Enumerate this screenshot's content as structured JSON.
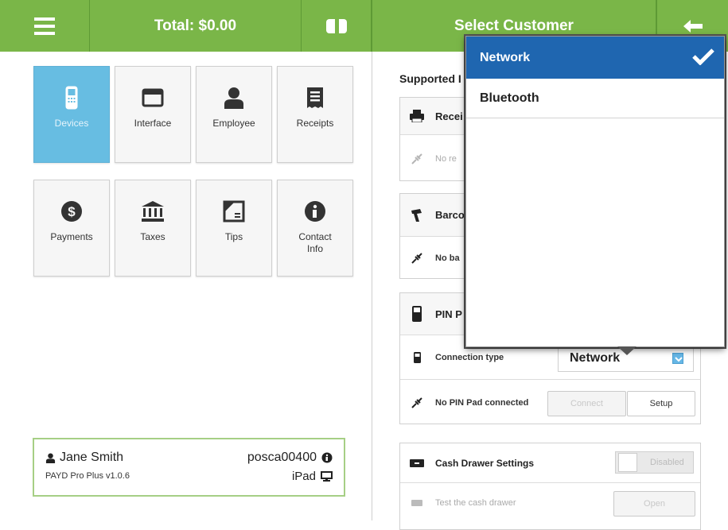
{
  "header": {
    "total_label": "Total: $0.00",
    "select_customer_label": "Select Customer",
    "menu_icon": "hamburger-menu-icon",
    "cash_icon": "cash-icon",
    "back_icon": "back-arrow-icon",
    "accent_color": "#7ab648"
  },
  "settings_tiles": [
    {
      "label": "Devices",
      "icon": "devices-icon",
      "active": true
    },
    {
      "label": "Interface",
      "icon": "window-icon",
      "active": false
    },
    {
      "label": "Employee",
      "icon": "person-icon",
      "active": false
    },
    {
      "label": "Receipts",
      "icon": "receipt-icon",
      "active": false
    },
    {
      "label": "Payments",
      "icon": "dollar-circle-icon",
      "active": false
    },
    {
      "label": "Taxes",
      "icon": "bank-icon",
      "active": false
    },
    {
      "label": "Tips",
      "icon": "tips-icon",
      "active": false
    },
    {
      "label": "Contact\nInfo",
      "icon": "info-icon",
      "active": false
    }
  ],
  "user_card": {
    "name": "Jane Smith",
    "version": "PAYD Pro Plus v1.0.6",
    "station_id": "posca00400",
    "device": "iPad"
  },
  "devices_panel": {
    "title": "Supported I",
    "receipt_printer": {
      "title": "Recei",
      "status": "No re"
    },
    "barcode_scanner": {
      "title": "Barco",
      "status": "No ba"
    },
    "pin_pad": {
      "title": "PIN P",
      "connection_type_label": "Connection type",
      "connection_type_value": "Network",
      "status": "No PIN Pad connected",
      "connect_label": "Connect",
      "setup_label": "Setup"
    },
    "cash_drawer": {
      "title": "Cash Drawer Settings",
      "toggle_label": "Disabled",
      "test_label": "Test the cash drawer",
      "open_label": "Open"
    }
  },
  "connection_dropdown": {
    "options": [
      {
        "label": "Network",
        "selected": true
      },
      {
        "label": "Bluetooth",
        "selected": false
      }
    ],
    "selected_color": "#1f66b0"
  }
}
